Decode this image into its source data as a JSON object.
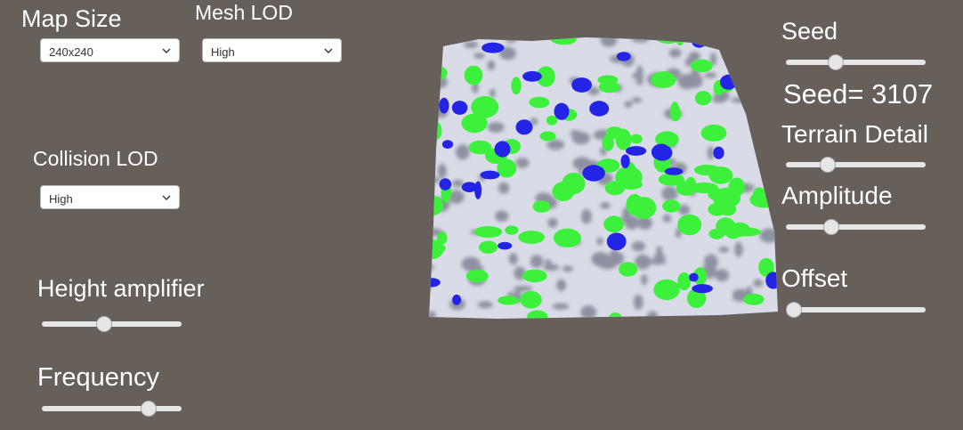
{
  "left_panel": {
    "map_size": {
      "label": "Map Size",
      "value": "240x240"
    },
    "mesh_lod": {
      "label": "Mesh LOD",
      "value": "High"
    },
    "collision_lod": {
      "label": "Collision LOD",
      "value": "High"
    },
    "height_amplifier": {
      "label": "Height amplifier",
      "level": 0.44
    },
    "frequency": {
      "label": "Frequency",
      "level": 0.8
    }
  },
  "right_panel": {
    "seed": {
      "label": "Seed",
      "level": 0.34
    },
    "seed_readout": "Seed= 3107",
    "terrain_detail": {
      "label": "Terrain Detail",
      "level": 0.27
    },
    "amplitude": {
      "label": "Amplitude",
      "level": 0.3
    },
    "offset": {
      "label": "Offset",
      "level": 0.0
    }
  },
  "terrain": {
    "colors": {
      "water": "#2424e6",
      "grass": "#3cf03c",
      "rock": "#d9dce6",
      "shadow": "#8e92a0"
    }
  }
}
